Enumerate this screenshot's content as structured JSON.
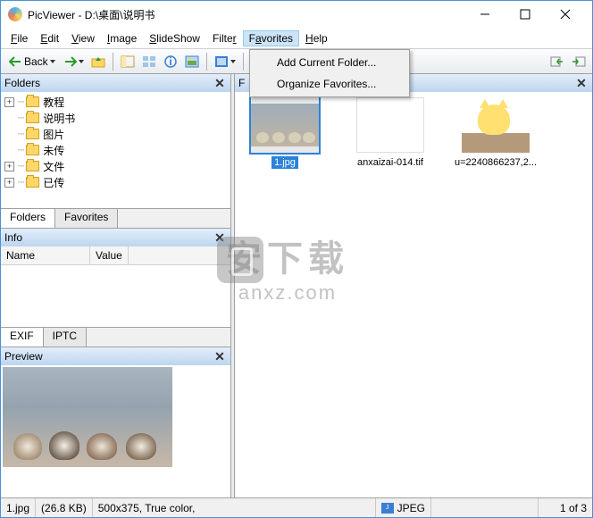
{
  "window": {
    "title": "PicViewer - D:\\桌面\\说明书"
  },
  "menu": {
    "file": "File",
    "edit": "Edit",
    "view": "View",
    "image": "Image",
    "slideshow": "SlideShow",
    "filter": "Filter",
    "favorites": "Favorites",
    "help": "Help"
  },
  "favorites_dropdown": {
    "add": "Add Current Folder...",
    "organize": "Organize Favorites..."
  },
  "toolbar": {
    "back": "Back"
  },
  "panels": {
    "folders_title": "Folders",
    "files_title": "F",
    "info_title": "Info",
    "preview_title": "Preview"
  },
  "tree": {
    "items": [
      {
        "label": "教程",
        "toggle": "+"
      },
      {
        "label": "说明书",
        "toggle": ""
      },
      {
        "label": "图片",
        "toggle": ""
      },
      {
        "label": "未传",
        "toggle": ""
      },
      {
        "label": "文件",
        "toggle": "+"
      },
      {
        "label": "已传",
        "toggle": "+"
      }
    ]
  },
  "left_tabs": {
    "folders": "Folders",
    "favorites": "Favorites"
  },
  "info": {
    "col_name": "Name",
    "col_value": "Value"
  },
  "info_tabs": {
    "exif": "EXIF",
    "iptc": "IPTC"
  },
  "thumbnails": [
    {
      "label": "1.jpg",
      "selected": true
    },
    {
      "label": "anxaizai-014.tif",
      "selected": false
    },
    {
      "label": "u=2240866237,2...",
      "selected": false
    }
  ],
  "status": {
    "filename": "1.jpg",
    "filesize": "(26.8 KB)",
    "dims": "500x375, True color,",
    "format": "JPEG",
    "position": "1 of 3"
  },
  "watermark": {
    "cn": "安下载",
    "en": "anxz.com"
  }
}
